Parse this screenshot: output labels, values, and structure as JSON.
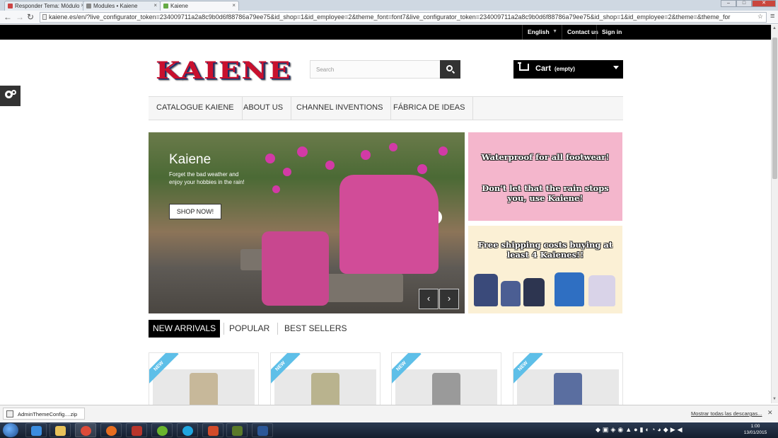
{
  "browser": {
    "tabs": [
      {
        "title": "Responder Tema: Módulo"
      },
      {
        "title": "Modules • Kaiene"
      },
      {
        "title": "Kaiene"
      }
    ],
    "url": "kaiene.es/en/?live_configurator_token=234009711a2a8c9b0d6f88786a79ee75&id_shop=1&id_employee=2&theme_font=font7&live_configurator_token=234009711a2a8c9b0d6f88786a79ee75&id_shop=1&id_employee=2&theme=&theme_for"
  },
  "topbar": {
    "language": "English",
    "contact": "Contact us",
    "signin": "Sign in"
  },
  "header": {
    "logo_text": "KAIENE",
    "search_placeholder": "Search",
    "cart_label": "Cart",
    "cart_status": "(empty)"
  },
  "nav": {
    "items": [
      "CATALOGUE KAIENE",
      "ABOUT US",
      "CHANNEL INVENTIONS",
      "FÁBRICA DE IDEAS"
    ]
  },
  "hero": {
    "title": "Kaiene",
    "text": "Forget the bad weather and enjoy your hobbies in the rain!",
    "button": "SHOP NOW!"
  },
  "banners": {
    "banner1_line1": "Waterproof for all footwear!",
    "banner1_line2": "Don't let that the rain stops you, use Kaiene!",
    "banner2_text": "Free shipping costs buying at least 4 Kaienes!!"
  },
  "product_tabs": [
    "NEW ARRIVALS",
    "POPULAR",
    "BEST SELLERS"
  ],
  "products": [
    {
      "badge": "NEW"
    },
    {
      "badge": "NEW"
    },
    {
      "badge": "NEW"
    },
    {
      "badge": "NEW"
    }
  ],
  "downloads": {
    "file": "AdminThemeConfig....zip",
    "show_all": "Mostrar todas las descargas..."
  },
  "taskbar": {
    "time": "1:00",
    "date": "13/01/2015"
  }
}
